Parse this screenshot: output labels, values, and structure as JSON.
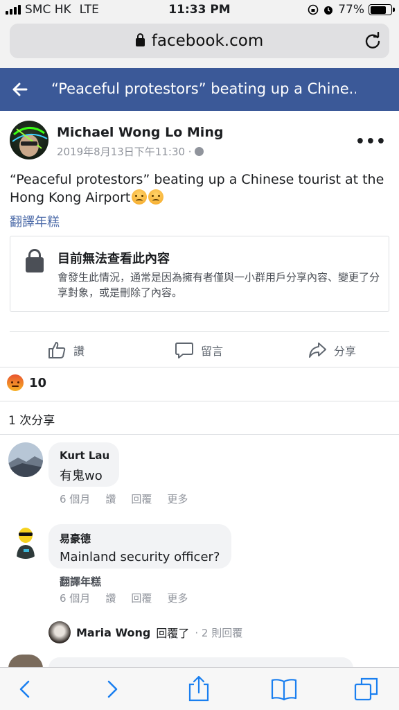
{
  "status_bar": {
    "carrier": "SMC HK",
    "network": "LTE",
    "time": "11:33 PM",
    "battery": "77%",
    "battery_level": 0.77
  },
  "browser": {
    "url": "facebook.com"
  },
  "header": {
    "title": "“Peaceful protestors” beating up a Chine..."
  },
  "post": {
    "author": "Michael Wong Lo Ming",
    "timestamp": "2019年8月13日下午11:30 ·",
    "text": "“Peaceful protestors” beating up a Chinese tourist at the Hong Kong Airport",
    "translate": "翻譯年糕",
    "unavailable_title": "目前無法查看此內容",
    "unavailable_desc": "會發生此情況，通常是因為擁有者僅與一小群用戶分享內容、變更了分享對象，或是刪除了內容。",
    "actions": {
      "like": "讚",
      "comment": "留言",
      "share": "分享"
    },
    "reaction_count": "10",
    "shares": "1 次分享"
  },
  "comments": [
    {
      "name": "Kurt Lau",
      "text": "有鬼wo",
      "time": "6 個月",
      "like": "讚",
      "reply": "回覆",
      "more": "更多"
    },
    {
      "name": "易豪德",
      "text": "Mainland security officer?",
      "translate": "翻譯年糕",
      "time": "6 個月",
      "like": "讚",
      "reply": "回覆",
      "more": "更多"
    }
  ],
  "reply_summary": {
    "name": "Maria Wong",
    "verb": "回覆了",
    "count": "· 2 則回覆"
  },
  "colors": {
    "facebook_blue": "#3b5998",
    "link_blue": "#4b6aa8",
    "ios_blue": "#1a7ff0"
  }
}
